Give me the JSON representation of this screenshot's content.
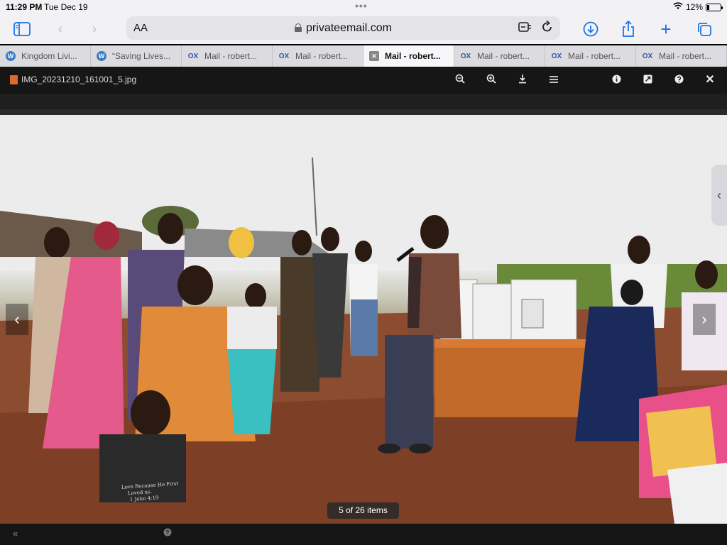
{
  "status": {
    "time": "11:29 PM",
    "date": "Tue Dec 19",
    "battery": "12%"
  },
  "toolbar": {
    "aa_label": "AA",
    "url": "privateemail.com"
  },
  "tabs": [
    {
      "label": "Kingdom Livi...",
      "favicon": "wp"
    },
    {
      "label": "“Saving Lives...",
      "favicon": "wp"
    },
    {
      "label": "Mail - robert...",
      "favicon": "ox"
    },
    {
      "label": "Mail - robert...",
      "favicon": "ox"
    },
    {
      "label": "Mail - robert...",
      "favicon": "close",
      "active": true
    },
    {
      "label": "Mail - robert...",
      "favicon": "ox"
    },
    {
      "label": "Mail - robert...",
      "favicon": "ox"
    },
    {
      "label": "Mail - robert...",
      "favicon": "ox"
    }
  ],
  "viewer": {
    "filename": "IMG_20231210_161001_5.jpg",
    "counter": "5 of 26 items"
  },
  "shirt_text": "Love Because He First Loved us. 1 John 4:19"
}
